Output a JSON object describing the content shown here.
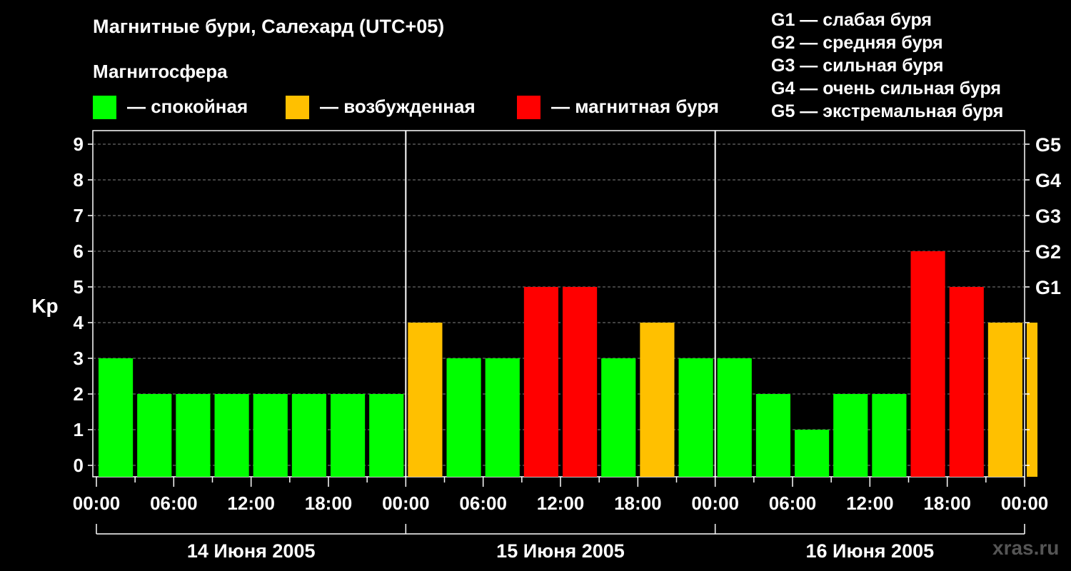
{
  "title": "Магнитные бури, Салехард (UTC+05)",
  "legend": {
    "heading": "Магнитосфера",
    "items": [
      {
        "label": "— спокойная",
        "color": "#00ff00"
      },
      {
        "label": "— возбужденная",
        "color": "#ffc000"
      },
      {
        "label": "— магнитная буря",
        "color": "#ff0000"
      }
    ]
  },
  "storm_scale": [
    "G1 — слабая буря",
    "G2 — средняя буря",
    "G3 — сильная буря",
    "G4 — очень сильная буря",
    "G5 — экстремальная буря"
  ],
  "watermark": "xras.ru",
  "chart_data": {
    "type": "bar",
    "ylabel": "Kp",
    "ylim": [
      0,
      9
    ],
    "yticks": [
      "0",
      "1",
      "2",
      "3",
      "4",
      "5",
      "6",
      "7",
      "8",
      "9"
    ],
    "right_ticks": [
      {
        "value": 5,
        "label": "G1"
      },
      {
        "value": 6,
        "label": "G2"
      },
      {
        "value": 7,
        "label": "G3"
      },
      {
        "value": 8,
        "label": "G4"
      },
      {
        "value": 9,
        "label": "G5"
      }
    ],
    "xtick_labels": [
      "00:00",
      "06:00",
      "12:00",
      "18:00",
      "00:00",
      "06:00",
      "12:00",
      "18:00",
      "00:00",
      "06:00",
      "12:00",
      "18:00",
      "00:00"
    ],
    "days": [
      "14 Июня 2005",
      "15 Июня 2005",
      "16 Июня 2005"
    ],
    "hours_per_bar": 3,
    "values": [
      3,
      2,
      2,
      2,
      2,
      2,
      2,
      2,
      4,
      3,
      3,
      5,
      5,
      3,
      4,
      3,
      3,
      2,
      1,
      2,
      2,
      6,
      5,
      4,
      4
    ],
    "last_bar_hours": 1,
    "grid": true,
    "colors": {
      "quiet": "#00ff00",
      "active": "#ffc000",
      "storm": "#ff0000"
    }
  }
}
